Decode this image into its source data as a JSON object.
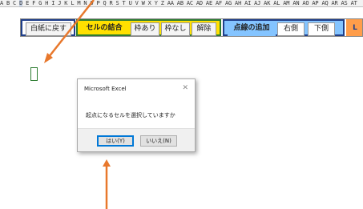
{
  "column_header": {
    "before": "A B C ",
    "selected": "D",
    "after": " E F G H I J K L M N O P Q R S T U V W X Y Z AA AB AC AD AE AF AG AH AI AJ AK AL AM AN AO AP AQ AR AS AT"
  },
  "toolbar": {
    "reset_white": "白紙に戻す",
    "merge_title": "セルの結合",
    "with_border": "枠あり",
    "no_border": "枠なし",
    "unmerge": "解除",
    "dotted_title": "点線の追加",
    "right_side": "右側",
    "bottom_side": "下側",
    "clipped_next": "L"
  },
  "colors": {
    "group_blue": "#1f3f8a",
    "group_green": "#2e7d32",
    "group_yellow_fill": "#ffe000",
    "group_green_fill": "#b5ff85",
    "group_blue_fill": "#84c4ff",
    "group_orange": "#ff9d4a",
    "arrow": "#e8782c",
    "cell_cursor": "#2e7d32"
  },
  "dialog": {
    "title": "Microsoft Excel",
    "close": "✕",
    "message": "起点になるセルを選択していますか",
    "yes_label": "はい(Y)",
    "no_label": "いいえ(N)"
  }
}
